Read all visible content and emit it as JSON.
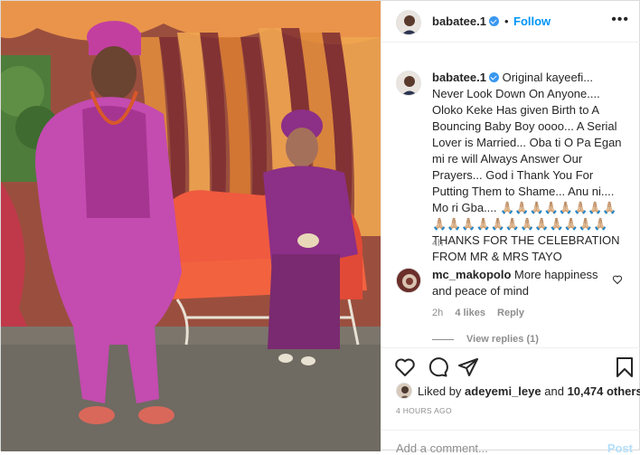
{
  "post": {
    "username": "babatee.1",
    "follow_sep": "•",
    "follow_label": "Follow",
    "more_label": "•••"
  },
  "caption": {
    "username": "babatee.1",
    "text": "Original kayeefi... Never Look Down On Anyone.... Oloko Keke Has given Birth to A Bouncing Baby Boy oooo... A Serial Lover is Married... Oba ti O Pa Egan mi re will Always Answer Our Prayers... God i Thank You For Putting Them to Shame... Anu ni.... Mo ri Gba.... 🙏🏼🙏🏼🙏🏼🙏🏼🙏🏼🙏🏼🙏🏼🙏🏼🙏🏼🙏🏼🙏🏼🙏🏼🙏🏼🙏🏼🙏🏼🙏🏼🙏🏼🙏🏼🙏🏼🙏🏼 THANKS FOR THE CELEBRATION FROM MR & MRS TAYO",
    "time": "4h"
  },
  "comment": {
    "username": "mc_makopolo",
    "text": "More happiness and peace of mind",
    "time": "2h",
    "likes": "4 likes",
    "reply_label": "Reply",
    "view_replies": "View replies (1)"
  },
  "likes": {
    "prefix": "Liked by",
    "user": "adeyemi_leye",
    "middle": "and",
    "count": "10,474 others"
  },
  "posted_ago": "4 HOURS AGO",
  "add_comment": {
    "placeholder": "Add a comment...",
    "post_label": "Post"
  },
  "colors": {
    "link_blue": "#0095f6",
    "verified_blue": "#3897f0",
    "muted": "#8e8e8e",
    "text": "#262626"
  },
  "icons": [
    "heart-icon",
    "comment-icon",
    "share-icon",
    "bookmark-icon",
    "more-icon",
    "verified-icon",
    "small-heart-icon"
  ]
}
